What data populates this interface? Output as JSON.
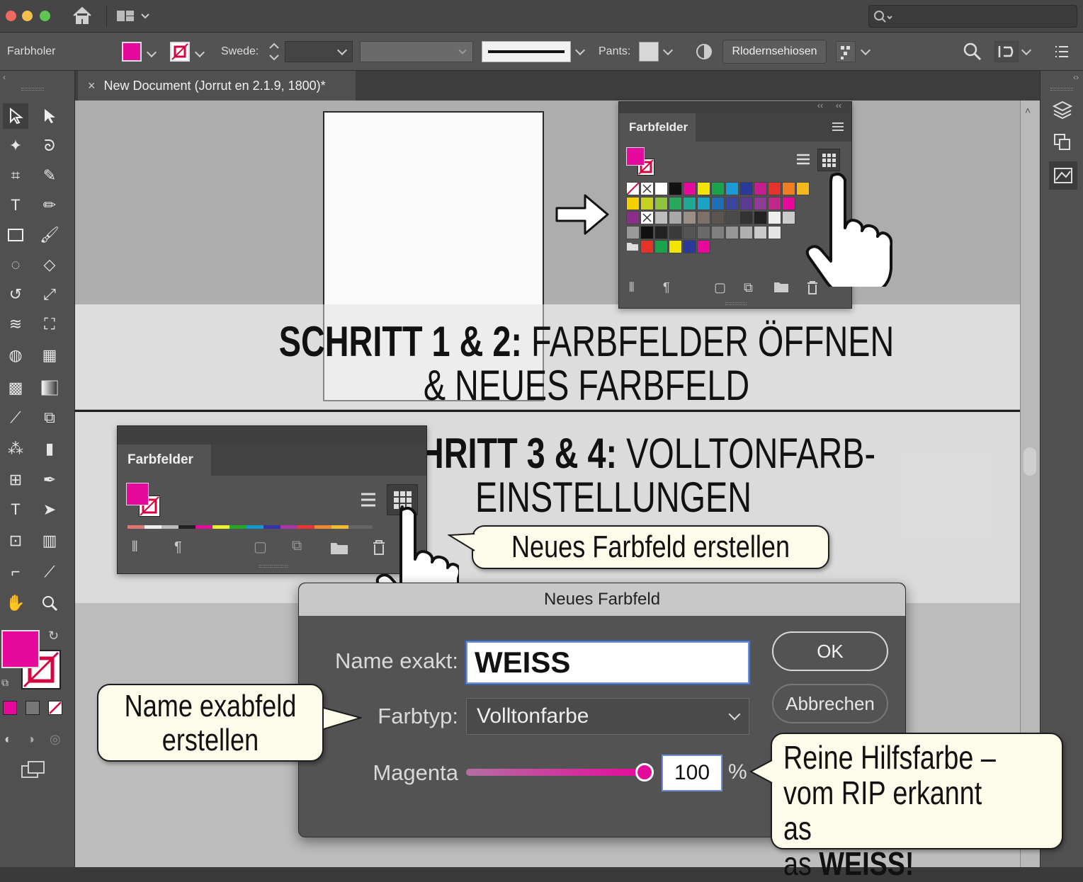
{
  "controlbar": {
    "doc_label": "Farbholer",
    "stroke_label": "Swede:",
    "points_label": "Pants:",
    "recolor_button": "Rlodernsehiosen"
  },
  "tab": {
    "title": "New Document (Jorrut en 2.1.9, 1800)*",
    "close": "×"
  },
  "swatches_panel_top": {
    "title": "Farbfelder"
  },
  "swatches_panel_bottom": {
    "title": "Farbfelder"
  },
  "headline_1": {
    "bold": "SCHRITT 1 & 2:",
    "rest": "FARBFELDER ÖFFNEN",
    "line2": "& NEUES FARBFELD"
  },
  "headline_2": {
    "bold": "SCHRITT 3 & 4:",
    "rest": "VOLLTONFARB-",
    "line2": "EINSTELLUNGEN"
  },
  "callouts": {
    "new_swatch": "Neues Farbfeld erstellen",
    "name_field_line1": "Name exabfeld",
    "name_field_line2": "erstellen",
    "helper_line1": "Reine Hilfsfarbe –",
    "helper_line2": "vom RIP erkannt as",
    "helper_line3_prefix": "as ",
    "helper_line3_bold": "WEISS!"
  },
  "dialog": {
    "title": "Neues Farbfeld",
    "name_label": "Name exakt:",
    "name_value": "WEISS",
    "type_label": "Farbtyp:",
    "type_value": "Volltonfarbe",
    "magenta_label": "Magenta",
    "magenta_value": "100",
    "percent": "%",
    "ok": "OK",
    "cancel": "Abbrechen"
  },
  "colors": {
    "accent_magenta": "#e5099c",
    "ui_dark": "#535353",
    "callout_bg": "#fdfbe9"
  },
  "magenta_level": 1.0
}
